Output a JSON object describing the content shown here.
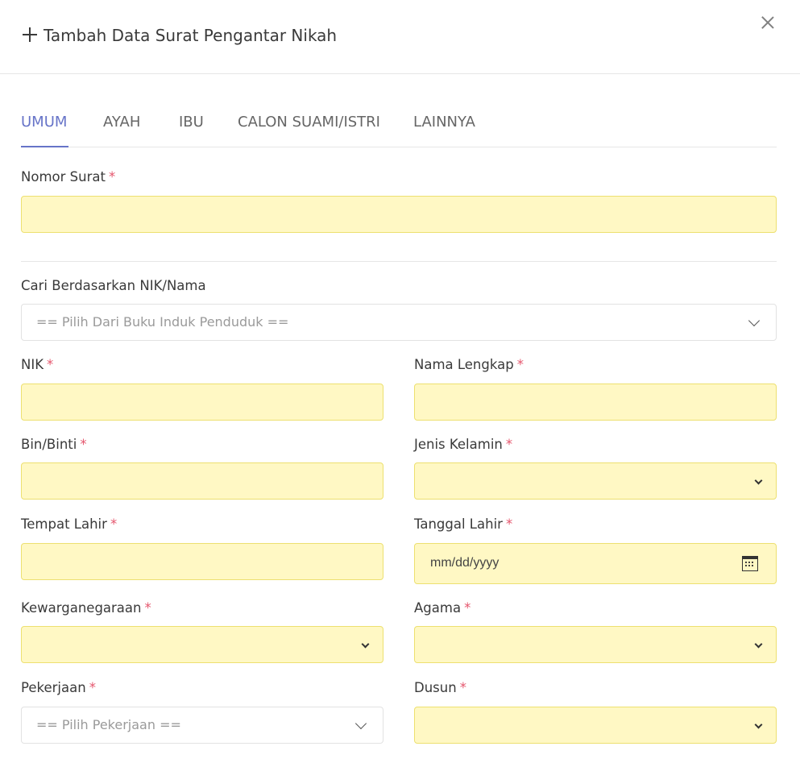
{
  "modal": {
    "title": "Tambah Data Surat Pengantar Nikah"
  },
  "tabs": [
    {
      "label": "UMUM"
    },
    {
      "label": "AYAH"
    },
    {
      "label": "IBU"
    },
    {
      "label": "CALON SUAMI/ISTRI"
    },
    {
      "label": "LAINNYA"
    }
  ],
  "form": {
    "required_mark": "*",
    "nomor_surat": {
      "label": "Nomor Surat",
      "value": ""
    },
    "cari": {
      "label": "Cari Berdasarkan NIK/Nama",
      "placeholder": "== Pilih Dari Buku Induk Penduduk =="
    },
    "nik": {
      "label": "NIK",
      "value": ""
    },
    "nama_lengkap": {
      "label": "Nama Lengkap",
      "value": ""
    },
    "bin_binti": {
      "label": "Bin/Binti",
      "value": ""
    },
    "jenis_kelamin": {
      "label": "Jenis Kelamin",
      "value": ""
    },
    "tempat_lahir": {
      "label": "Tempat Lahir",
      "value": ""
    },
    "tanggal_lahir": {
      "label": "Tanggal Lahir",
      "placeholder": "mm/dd/yyyy"
    },
    "kewarganegaraan": {
      "label": "Kewarganegaraan",
      "value": ""
    },
    "agama": {
      "label": "Agama",
      "value": ""
    },
    "pekerjaan": {
      "label": "Pekerjaan",
      "placeholder": "== Pilih Pekerjaan =="
    },
    "dusun": {
      "label": "Dusun",
      "value": ""
    }
  },
  "colors": {
    "accent": "#6774c8",
    "required": "#e5566d",
    "field_highlight": "#fff8c4"
  }
}
